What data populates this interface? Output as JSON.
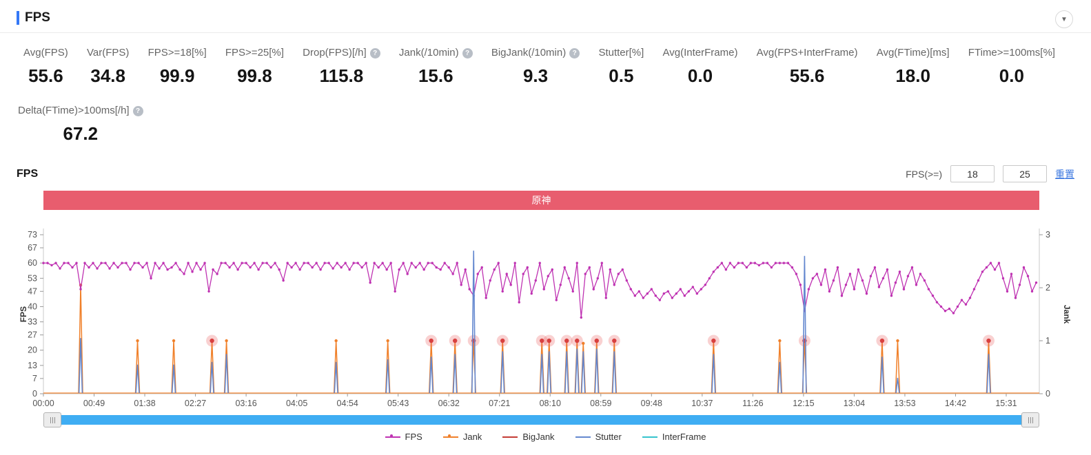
{
  "header": {
    "title": "FPS"
  },
  "icons": {
    "help": "?",
    "collapse": "▼",
    "grip": "|||"
  },
  "colors": {
    "accent_blue": "#3478f6",
    "banner_red": "#e85d6e",
    "link_blue": "#3f7ae0",
    "scrollbar_blue": "#3fadf3",
    "fps_line": "#bf32b2",
    "jank_orange": "#f0802a",
    "bigjank_red": "#d84040",
    "stutter_blue": "#6488cf",
    "interframe_cyan": "#35c3cd"
  },
  "stats_row1": [
    {
      "id": "avg-fps",
      "label": "Avg(FPS)",
      "value": "55.6",
      "help": false
    },
    {
      "id": "var-fps",
      "label": "Var(FPS)",
      "value": "34.8",
      "help": false
    },
    {
      "id": "fps-ge-18",
      "label": "FPS>=18[%]",
      "value": "99.9",
      "help": false
    },
    {
      "id": "fps-ge-25",
      "label": "FPS>=25[%]",
      "value": "99.8",
      "help": false
    },
    {
      "id": "drop-fps",
      "label": "Drop(FPS)[/h]",
      "value": "115.8",
      "help": true
    },
    {
      "id": "jank-10min",
      "label": "Jank(/10min)",
      "value": "15.6",
      "help": true
    },
    {
      "id": "bigjank-10min",
      "label": "BigJank(/10min)",
      "value": "9.3",
      "help": true
    },
    {
      "id": "stutter",
      "label": "Stutter[%]",
      "value": "0.5",
      "help": false
    },
    {
      "id": "avg-interframe",
      "label": "Avg(InterFrame)",
      "value": "0.0",
      "help": false
    },
    {
      "id": "avg-fps-interframe",
      "label": "Avg(FPS+InterFrame)",
      "value": "55.6",
      "help": false
    },
    {
      "id": "avg-ftime",
      "label": "Avg(FTime)[ms]",
      "value": "18.0",
      "help": false
    },
    {
      "id": "ftime-ge-100ms",
      "label": "FTime>=100ms[%]",
      "value": "0.0",
      "help": false
    }
  ],
  "stats_row2": [
    {
      "id": "delta-ftime-100ms",
      "label": "Delta(FTime)>100ms[/h]",
      "value": "67.2",
      "help": true
    }
  ],
  "chart_section": {
    "title": "FPS",
    "filter": {
      "label": "FPS(>=)",
      "value1": "18",
      "value2": "25",
      "reset_label": "重置"
    },
    "banner": {
      "text": "原神",
      "color": "#e85d6e"
    }
  },
  "chart_data": {
    "type": "line",
    "title": "原神",
    "left_axis": {
      "label": "FPS",
      "max": 73,
      "ticks": [
        73,
        67,
        60,
        53,
        47,
        40,
        33,
        27,
        20,
        13,
        7,
        0
      ]
    },
    "right_axis": {
      "label": "Jank",
      "max": 3,
      "ticks": [
        3,
        2,
        1,
        0
      ]
    },
    "x_axis": {
      "tick_interval_s": 49,
      "total_seconds": 963,
      "tick_labels": [
        "00:00",
        "00:49",
        "01:38",
        "02:27",
        "03:16",
        "04:05",
        "04:54",
        "05:43",
        "06:32",
        "07:21",
        "08:10",
        "08:59",
        "09:48",
        "10:37",
        "11:26",
        "12:15",
        "13:04",
        "13:53",
        "14:42",
        "15:31"
      ]
    },
    "fps_series": {
      "name": "FPS",
      "color": "#bf32b2",
      "axis": "left",
      "t_start": 0,
      "t_step": 4,
      "values": [
        60,
        60,
        59,
        60,
        57.5,
        60,
        60,
        58,
        60,
        48,
        60,
        58,
        60,
        57.5,
        60,
        60,
        57.5,
        60,
        58,
        60,
        60,
        57,
        60,
        60,
        58,
        60,
        53,
        60,
        57.5,
        60,
        57,
        58,
        60,
        57,
        55,
        60,
        56,
        60,
        57,
        60,
        47,
        57,
        55,
        60,
        60,
        58,
        60,
        57,
        60,
        60,
        58,
        60,
        57,
        60,
        60,
        58,
        60,
        57,
        52,
        60,
        58,
        60,
        57,
        60,
        60,
        58,
        60,
        57,
        60,
        60,
        57.5,
        60,
        58,
        60,
        57,
        60,
        60,
        58,
        60,
        51,
        60,
        58,
        60,
        57,
        60,
        47,
        57,
        60,
        55,
        60,
        58,
        60,
        57,
        60,
        60,
        58,
        57,
        60,
        58,
        55,
        60,
        50,
        57,
        48,
        45,
        55,
        58,
        44,
        52,
        57,
        60,
        47,
        55,
        50,
        60,
        42,
        55,
        58,
        46,
        52,
        60,
        48,
        54,
        57,
        43,
        50,
        58,
        53,
        47,
        60,
        35,
        55,
        58,
        48,
        53,
        60,
        44,
        57,
        50,
        55,
        57,
        52,
        48,
        45,
        47,
        44,
        46,
        48,
        45,
        43,
        46,
        47,
        44,
        46,
        48,
        45,
        47,
        49,
        46,
        48,
        50,
        53,
        56,
        58,
        60,
        57,
        60,
        58,
        60,
        60,
        58,
        60,
        60,
        59,
        60,
        60,
        58,
        60,
        60,
        60,
        60,
        58,
        55,
        50,
        38,
        48,
        53,
        55,
        50,
        57,
        47,
        52,
        58,
        45,
        50,
        55,
        48,
        57,
        52,
        46,
        54,
        58,
        49,
        53,
        57,
        45,
        51,
        56,
        48,
        54,
        58,
        50,
        55,
        52,
        48,
        45,
        42,
        40,
        38,
        39,
        37,
        40,
        43,
        41,
        44,
        48,
        52,
        56,
        58,
        60,
        57,
        60,
        53,
        47,
        55,
        44,
        50,
        58,
        54,
        47,
        51
      ]
    },
    "jank_events": [
      {
        "t": 36,
        "jank": 2.05,
        "stutter": 1.05,
        "bigjank": false
      },
      {
        "t": 91,
        "jank": 1,
        "stutter": 0.55,
        "bigjank": false
      },
      {
        "t": 126,
        "jank": 1,
        "stutter": 0.55,
        "bigjank": false
      },
      {
        "t": 163,
        "jank": 1,
        "stutter": 0.6,
        "bigjank": true
      },
      {
        "t": 177,
        "jank": 1,
        "stutter": 0.75,
        "bigjank": false
      },
      {
        "t": 283,
        "jank": 1,
        "stutter": 0.6,
        "bigjank": false
      },
      {
        "t": 333,
        "jank": 1,
        "stutter": 0.65,
        "bigjank": false
      },
      {
        "t": 375,
        "jank": 1,
        "stutter": 0.7,
        "bigjank": true
      },
      {
        "t": 398,
        "jank": 1,
        "stutter": 0.75,
        "bigjank": true
      },
      {
        "t": 416,
        "jank": 1,
        "stutter": 2.7,
        "bigjank": true
      },
      {
        "t": 444,
        "jank": 1,
        "stutter": 0.8,
        "bigjank": true
      },
      {
        "t": 482,
        "jank": 1,
        "stutter": 0.75,
        "bigjank": true
      },
      {
        "t": 489,
        "jank": 1,
        "stutter": 0.8,
        "bigjank": true
      },
      {
        "t": 506,
        "jank": 1,
        "stutter": 0.8,
        "bigjank": true
      },
      {
        "t": 516,
        "jank": 1,
        "stutter": 0.85,
        "bigjank": true
      },
      {
        "t": 522,
        "jank": 0.95,
        "stutter": 0.8,
        "bigjank": false
      },
      {
        "t": 535,
        "jank": 1,
        "stutter": 0.85,
        "bigjank": true
      },
      {
        "t": 552,
        "jank": 1,
        "stutter": 0.8,
        "bigjank": true
      },
      {
        "t": 648,
        "jank": 1,
        "stutter": 0.75,
        "bigjank": true
      },
      {
        "t": 712,
        "jank": 1,
        "stutter": 0.6,
        "bigjank": false
      },
      {
        "t": 736,
        "jank": 1,
        "stutter": 2.6,
        "bigjank": true
      },
      {
        "t": 811,
        "jank": 1,
        "stutter": 0.7,
        "bigjank": true
      },
      {
        "t": 826,
        "jank": 1,
        "stutter": 0.3,
        "bigjank": false
      },
      {
        "t": 914,
        "jank": 1,
        "stutter": 0.75,
        "bigjank": true
      }
    ],
    "interframe_baseline": 0,
    "legend_position": "bottom",
    "legend": [
      {
        "label": "FPS",
        "color": "#bf32b2",
        "marker": "dot"
      },
      {
        "label": "Jank",
        "color": "#f0802a",
        "marker": "dot"
      },
      {
        "label": "BigJank",
        "color": "#c43b34",
        "marker": "line"
      },
      {
        "label": "Stutter",
        "color": "#6488cf",
        "marker": "line"
      },
      {
        "label": "InterFrame",
        "color": "#35c3cd",
        "marker": "line"
      }
    ]
  }
}
